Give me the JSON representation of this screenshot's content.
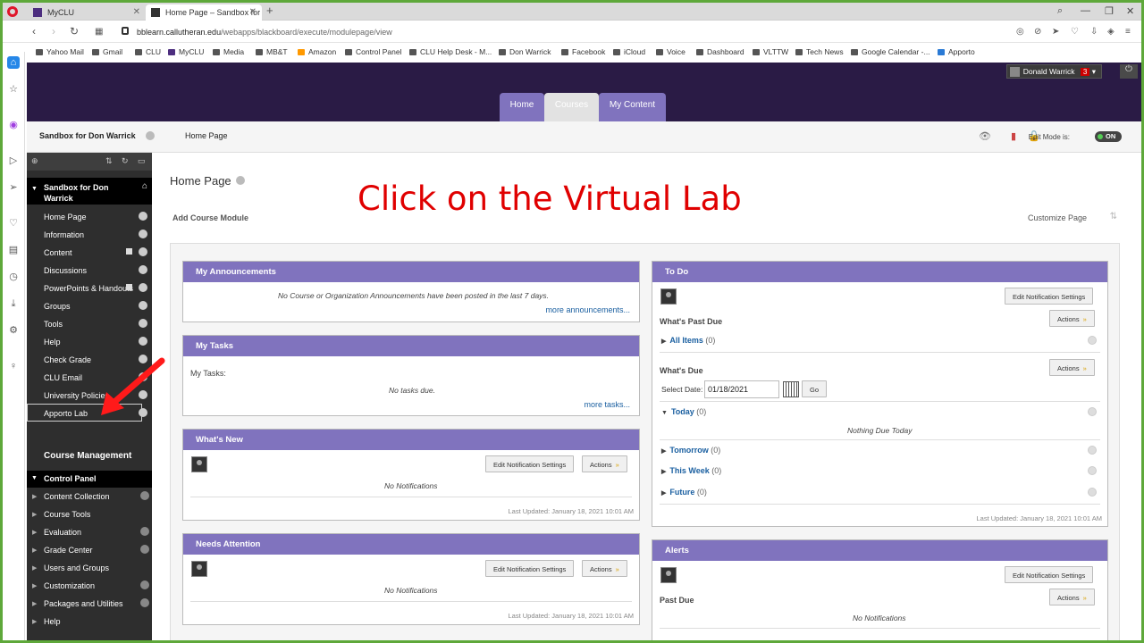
{
  "browser": {
    "tabs": [
      {
        "label": "MyCLU"
      },
      {
        "label": "Home Page – Sandbox for"
      }
    ],
    "url_host": "bblearn.callutheran.edu",
    "url_path": "/webapps/blackboard/execute/modulepage/view",
    "bookmarks": [
      "Yahoo Mail",
      "Gmail",
      "CLU",
      "MyCLU",
      "Media",
      "MB&T",
      "Amazon",
      "Control Panel",
      "CLU Help Desk - M...",
      "Don Warrick",
      "Facebook",
      "iCloud",
      "Voice",
      "Dashboard",
      "VLTTW",
      "Tech News",
      "Google Calendar -...",
      "Apporto"
    ]
  },
  "header": {
    "user_name": "Donald Warrick",
    "notification_count": "3",
    "tabs": {
      "home": "Home",
      "courses": "Courses",
      "my_content": "My Content"
    }
  },
  "crumb": {
    "course": "Sandbox for Don Warrick",
    "page": "Home Page",
    "edit_mode_label": "Edit Mode is:",
    "edit_mode_state": "ON"
  },
  "sidebar": {
    "course_title": "Sandbox for Don Warrick",
    "items": [
      "Home Page",
      "Information",
      "Content",
      "Discussions",
      "PowerPoints & Handouts",
      "Groups",
      "Tools",
      "Help",
      "Check Grade",
      "CLU Email",
      "University Policies",
      "Apporto Lab"
    ],
    "course_management": "Course Management",
    "control_panel": "Control Panel",
    "cp_items": [
      "Content Collection",
      "Course Tools",
      "Evaluation",
      "Grade Center",
      "Users and Groups",
      "Customization",
      "Packages and Utilities",
      "Help"
    ]
  },
  "main": {
    "title": "Home Page",
    "add_module": "Add Course Module",
    "customize": "Customize Page",
    "overlay_instruction": "Click on the Virtual Lab",
    "overlay_color": "#e00000"
  },
  "modules": {
    "announcements": {
      "title": "My Announcements",
      "empty": "No Course or Organization Announcements have been posted in the last 7 days.",
      "more": "more announcements..."
    },
    "tasks": {
      "title": "My Tasks",
      "label": "My Tasks:",
      "empty": "No tasks due.",
      "more": "more tasks..."
    },
    "whats_new": {
      "title": "What's New",
      "edit": "Edit Notification Settings",
      "actions": "Actions",
      "empty": "No Notifications",
      "updated": "Last Updated: January 18, 2021 10:01 AM"
    },
    "needs_attention": {
      "title": "Needs Attention",
      "edit": "Edit Notification Settings",
      "actions": "Actions",
      "empty": "No Notifications",
      "updated": "Last Updated: January 18, 2021 10:01 AM"
    },
    "todo": {
      "title": "To Do",
      "edit": "Edit Notification Settings",
      "past_due": "What's Past Due",
      "actions": "Actions",
      "all_items": "All Items",
      "all_items_count": "(0)",
      "whats_due": "What's Due",
      "select_date": "Select Date:",
      "date_value": "01/18/2021",
      "go": "Go",
      "today": "Today",
      "today_count": "(0)",
      "nothing_due": "Nothing Due Today",
      "tomorrow": "Tomorrow",
      "tomorrow_count": "(0)",
      "this_week": "This Week",
      "this_week_count": "(0)",
      "future": "Future",
      "future_count": "(0)",
      "updated": "Last Updated: January 18, 2021 10:01 AM"
    },
    "alerts": {
      "title": "Alerts",
      "edit": "Edit Notification Settings",
      "past_due": "Past Due",
      "actions": "Actions",
      "empty": "No Notifications"
    }
  },
  "colors": {
    "accent": "#8073be",
    "header_bg": "#2a1b45",
    "border": "#5ea83a"
  }
}
